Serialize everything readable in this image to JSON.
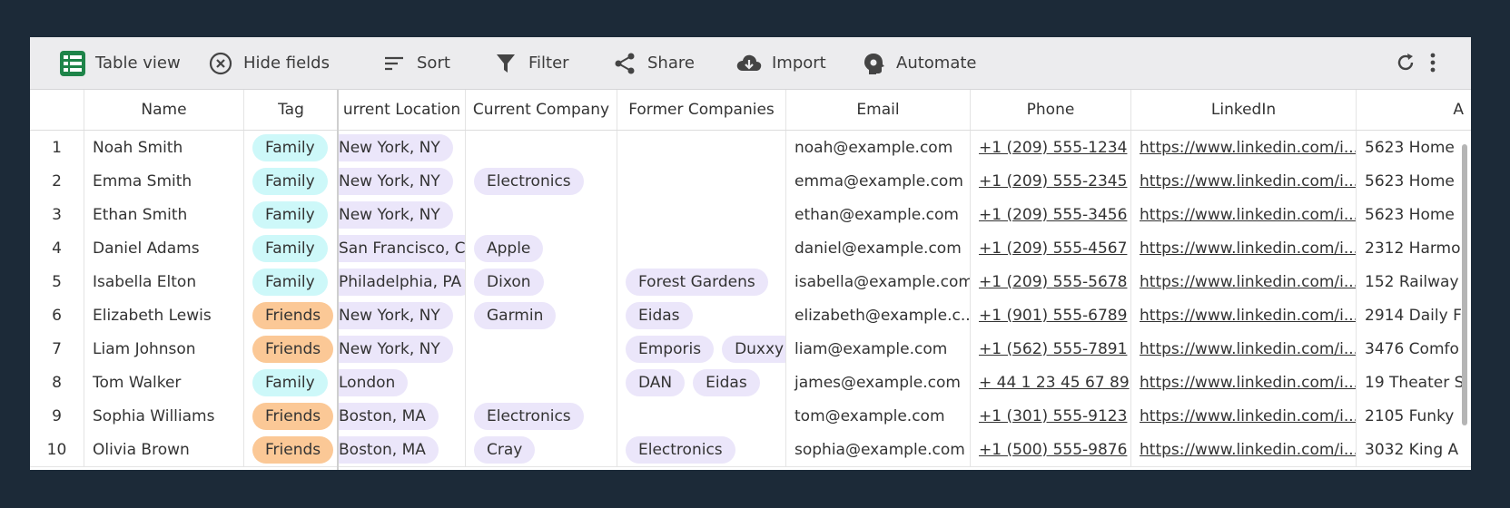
{
  "toolbar": {
    "table_view": "Table view",
    "hide_fields": "Hide fields",
    "sort": "Sort",
    "filter": "Filter",
    "share": "Share",
    "import": "Import",
    "automate": "Automate"
  },
  "columns": {
    "name": "Name",
    "tag": "Tag",
    "location": "urrent Location",
    "company": "Current Company",
    "former": "Former Companies",
    "email": "Email",
    "phone": "Phone",
    "linkedin": "LinkedIn",
    "address": "A"
  },
  "colors": {
    "family_chip": "#cdf8f9",
    "friends_chip": "#fbc896",
    "generic_chip": "#ebe6fa",
    "table_icon": "#1e8449"
  },
  "rows": [
    {
      "num": "1",
      "name": "Noah Smith",
      "tag": "Family",
      "location": "New York, NY",
      "company": "",
      "former": [],
      "email": "noah@example.com",
      "phone": "+1 (209) 555-1234",
      "linkedin": "https://www.linkedin.com/i...",
      "address": "5623 Home"
    },
    {
      "num": "2",
      "name": "Emma Smith",
      "tag": "Family",
      "location": "New York, NY",
      "company": "Electronics",
      "former": [],
      "email": "emma@example.com",
      "phone": "+1 (209) 555-2345",
      "linkedin": "https://www.linkedin.com/i...",
      "address": "5623 Home"
    },
    {
      "num": "3",
      "name": "Ethan Smith",
      "tag": "Family",
      "location": "New York, NY",
      "company": "",
      "former": [],
      "email": "ethan@example.com",
      "phone": "+1 (209) 555-3456",
      "linkedin": "https://www.linkedin.com/i...",
      "address": "5623 Home"
    },
    {
      "num": "4",
      "name": "Daniel Adams",
      "tag": "Family",
      "location": "San Francisco, CA",
      "company": "Apple",
      "former": [],
      "email": "daniel@example.com",
      "phone": "+1 (209) 555-4567",
      "linkedin": "https://www.linkedin.com/i...",
      "address": "2312 Harmo"
    },
    {
      "num": "5",
      "name": "Isabella Elton",
      "tag": "Family",
      "location": "Philadelphia, PA",
      "company": "Dixon",
      "former": [
        "Forest Gardens"
      ],
      "email": "isabella@example.com",
      "phone": "+1 (209) 555-5678",
      "linkedin": "https://www.linkedin.com/i...",
      "address": "152 Railway"
    },
    {
      "num": "6",
      "name": "Elizabeth Lewis",
      "tag": "Friends",
      "location": "New York, NY",
      "company": "Garmin",
      "former": [
        "Eidas"
      ],
      "email": "elizabeth@example.c...",
      "phone": "+1 (901) 555-6789",
      "linkedin": "https://www.linkedin.com/i...",
      "address": "2914 Daily F"
    },
    {
      "num": "7",
      "name": "Liam Johnson",
      "tag": "Friends",
      "location": "New York, NY",
      "company": "",
      "former": [
        "Emporis",
        "Duxxy"
      ],
      "email": "liam@example.com",
      "phone": "+1 (562) 555-7891",
      "linkedin": "https://www.linkedin.com/i...",
      "address": "3476 Comfo"
    },
    {
      "num": "8",
      "name": "Tom Walker",
      "tag": "Family",
      "location": "London",
      "company": "",
      "former": [
        "DAN",
        "Eidas"
      ],
      "email": "james@example.com",
      "phone": "+ 44 1 23 45 67 89",
      "linkedin": "https://www.linkedin.com/i...",
      "address": "19 Theater S"
    },
    {
      "num": "9",
      "name": "Sophia Williams",
      "tag": "Friends",
      "location": "Boston, MA",
      "company": "Electronics",
      "former": [],
      "email": "tom@example.com",
      "phone": "+1 (301) 555-9123",
      "linkedin": "https://www.linkedin.com/i...",
      "address": "2105 Funky"
    },
    {
      "num": "10",
      "name": "Olivia Brown",
      "tag": "Friends",
      "location": "Boston, MA",
      "company": "Cray",
      "former": [
        "Electronics"
      ],
      "email": "sophia@example.com",
      "phone": "+1 (500) 555-9876",
      "linkedin": "https://www.linkedin.com/i...",
      "address": "3032 King A"
    }
  ]
}
